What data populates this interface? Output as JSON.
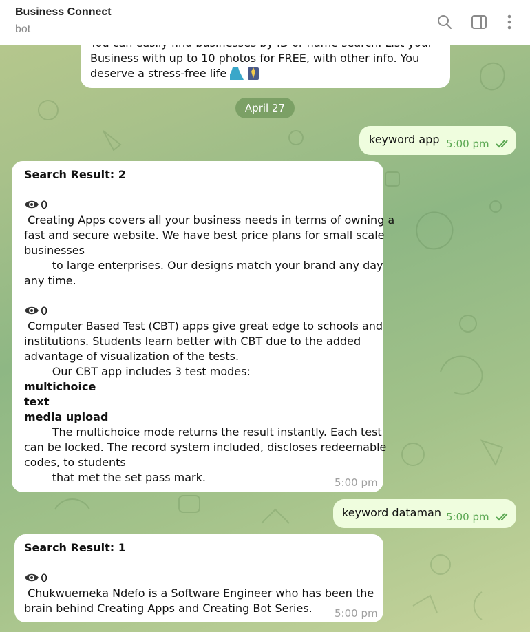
{
  "header": {
    "title": "Business Connect",
    "status": "bot",
    "icons": [
      "search-icon",
      "sidebar-toggle-icon",
      "more-vertical-icon"
    ]
  },
  "messages": {
    "intro": {
      "line1": "You can easily find businesses by ID or name search. List your",
      "line2": "Business with up to 10 photos for FREE, with other info. You",
      "line3": "deserve a stress-free life"
    },
    "date_separator": "April 27",
    "out1": {
      "text": "keyword app",
      "time": "5:00 pm"
    },
    "result2": {
      "title": "Search Result: 2",
      "entry1": {
        "views": "0",
        "l1": " Creating Apps covers all your business needs in terms of owning a",
        "l2": "fast and secure website. We have best price plans for small scale",
        "l3": "businesses",
        "l4": "        to large enterprises. Our designs match your brand any day",
        "l5": "any time."
      },
      "entry2": {
        "views": "0",
        "l1": " Computer Based Test (CBT) apps give great edge to schools and",
        "l2": "institutions. Students learn better with CBT due to the added",
        "l3": "advantage of visualization of the tests.",
        "l4": "        Our CBT app includes 3 test modes:",
        "mode1": "multichoice",
        "mode2": "text",
        "mode3": "media upload",
        "l5": "        The multichoice mode returns the result instantly. Each test",
        "l6": "can be locked. The record system included, discloses redeemable",
        "l7": "codes, to students",
        "l8": "        that met the set pass mark."
      },
      "time": "5:00 pm"
    },
    "out2": {
      "text": "keyword dataman",
      "time": "5:00 pm"
    },
    "result1": {
      "title": "Search Result: 1",
      "views": "0",
      "l1": " Chukwuemeka Ndefo is a Software Engineer who has been the",
      "l2": "brain behind Creating Apps and Creating Bot Series.",
      "time": "5:00 pm"
    }
  },
  "colors": {
    "incoming_bubble": "#ffffff",
    "outgoing_bubble": "#effdde",
    "outgoing_time": "#5ca853",
    "date_pill": "#6e965a"
  }
}
